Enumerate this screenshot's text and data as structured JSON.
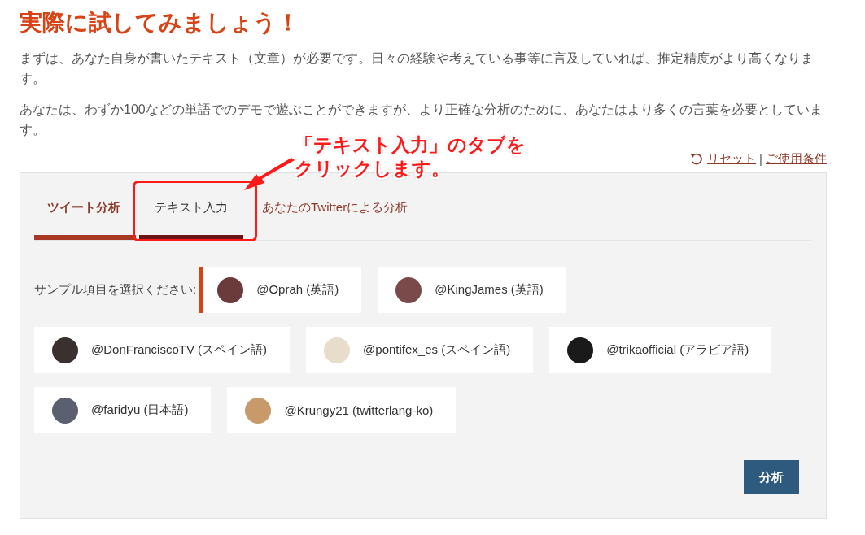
{
  "heading": "実際に試してみましょう！",
  "paragraphs": [
    "まずは、あなた自身が書いたテキスト（文章）が必要です。日々の経験や考えている事等に言及していれば、推定精度がより高くなります。",
    "あなたは、わずか100などの単語でのデモで遊ぶことができますが、より正確な分析のために、あなたはより多くの言葉を必要としています。"
  ],
  "links": {
    "reset": "リセット",
    "separator": "|",
    "terms": "ご使用条件"
  },
  "tabs": [
    {
      "label": "ツイート分析",
      "selected": true,
      "highlighted": false
    },
    {
      "label": "テキスト入力",
      "selected": false,
      "highlighted": true
    },
    {
      "label": "あなたのTwitterによる分析",
      "selected": false,
      "highlighted": false
    }
  ],
  "sample_label": "サンプル項目を選択ください:",
  "samples": [
    {
      "label": "@Oprah (英語)",
      "selected": true,
      "color": "#6b3a3a"
    },
    {
      "label": "@KingJames (英語)",
      "selected": false,
      "color": "#7a4a4a"
    },
    {
      "label": "@DonFranciscoTV (スペイン語)",
      "selected": false,
      "color": "#3a3030"
    },
    {
      "label": "@pontifex_es (スペイン語)",
      "selected": false,
      "color": "#e8dccb"
    },
    {
      "label": "@trikaofficial (アラビア語)",
      "selected": false,
      "color": "#1a1a1a"
    },
    {
      "label": "@faridyu (日本語)",
      "selected": false,
      "color": "#5a6070"
    },
    {
      "label": "@Krungy21 (twitterlang-ko)",
      "selected": false,
      "color": "#c89a6a"
    }
  ],
  "analyze_button": "分析",
  "callout": {
    "lines": [
      "「テキスト入力」のタブを",
      "クリックします。"
    ]
  }
}
